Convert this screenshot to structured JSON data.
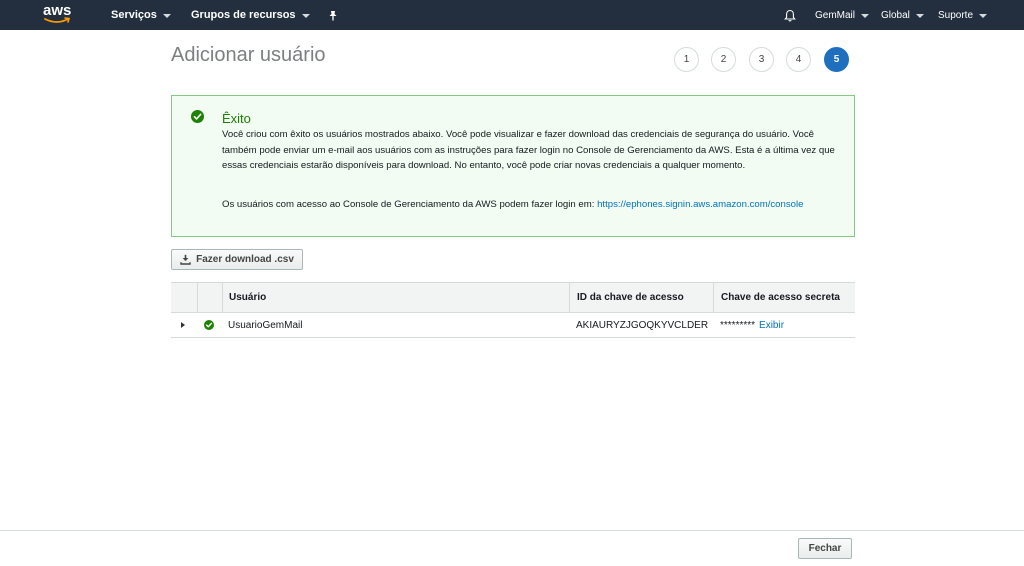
{
  "nav": {
    "logo_text": "aws",
    "services": "Serviços",
    "resource_groups": "Grupos de recursos",
    "account": "GemMail",
    "region": "Global",
    "support": "Suporte"
  },
  "page": {
    "title": "Adicionar usuário"
  },
  "steps": [
    {
      "label": "1"
    },
    {
      "label": "2"
    },
    {
      "label": "3"
    },
    {
      "label": "4"
    },
    {
      "label": "5"
    }
  ],
  "alert": {
    "title": "Êxito",
    "message": "Você criou com êxito os usuários mostrados abaixo. Você pode visualizar e fazer download das credenciais de segurança do usuário. Você também pode enviar um e-mail aos usuários com as instruções para fazer login no Console de Gerenciamento da AWS. Esta é a última vez que essas credenciais estarão disponíveis para download. No entanto, você pode criar novas credenciais a qualquer momento.",
    "login_prefix": "Os usuários com acesso ao Console de Gerenciamento da AWS podem fazer login em:",
    "login_url": "https://ephones.signin.aws.amazon.com/console"
  },
  "download_button": "Fazer download .csv",
  "table": {
    "headers": {
      "user": "Usuário",
      "access_key_id": "ID da chave de acesso",
      "secret_key": "Chave de acesso secreta"
    },
    "rows": [
      {
        "user": "UsuarioGemMail",
        "access_key_id": "AKIAURYZJGOQKYVCLDER",
        "secret_mask": "*********",
        "show_label": "Exibir"
      }
    ]
  },
  "footer": {
    "close_button": "Fechar"
  },
  "colors": {
    "nav_bg": "#232f3e",
    "success_green": "#1d8102",
    "step_active": "#1f6fbf",
    "link": "#0073bb"
  }
}
